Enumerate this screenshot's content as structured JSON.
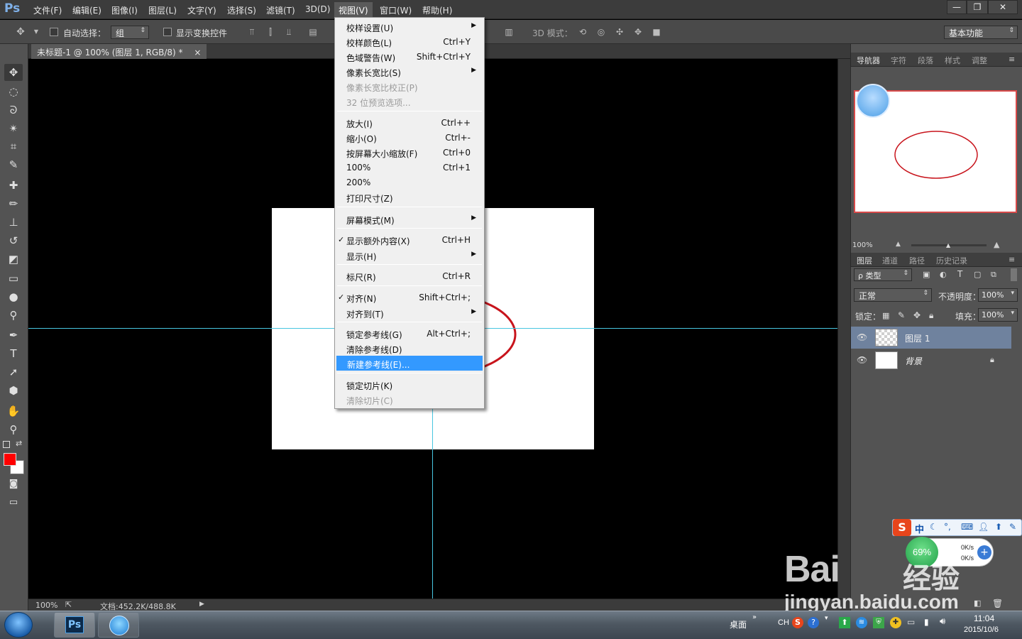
{
  "menubar": {
    "logo": "Ps",
    "items": [
      "文件(F)",
      "编辑(E)",
      "图像(I)",
      "图层(L)",
      "文字(Y)",
      "选择(S)",
      "滤镜(T)",
      "3D(D)",
      "视图(V)",
      "窗口(W)",
      "帮助(H)"
    ],
    "active_index": 8,
    "window_buttons": [
      "—",
      "❐",
      "✕"
    ]
  },
  "options": {
    "auto_select_label": "自动选择：",
    "auto_select_value": "组",
    "show_transform_label": "显示变换控件",
    "mode_3d_label": "3D 模式：",
    "workspace_value": "基本功能"
  },
  "document": {
    "tab_title": "未标题-1 @ 100% (图层 1, RGB/8) *",
    "tab_close": "×",
    "zoom": "100%",
    "doc_info": "文档:452.2K/488.8K",
    "colors": {
      "foreground": "#ff0000",
      "background": "#ffffff",
      "ellipse": "#c8141c",
      "guide": "#48c6e0"
    }
  },
  "view_menu": {
    "items": [
      {
        "label": "校样设置(U)",
        "shortcut": "",
        "submenu": true
      },
      {
        "label": "校样颜色(L)",
        "shortcut": "Ctrl+Y"
      },
      {
        "label": "色域警告(W)",
        "shortcut": "Shift+Ctrl+Y"
      },
      {
        "label": "像素长宽比(S)",
        "shortcut": "",
        "submenu": true
      },
      {
        "label": "像素长宽比校正(P)",
        "shortcut": "",
        "disabled": true
      },
      {
        "label": "32 位预览选项...",
        "shortcut": "",
        "disabled": true
      },
      {
        "label": "放大(I)",
        "shortcut": "Ctrl++"
      },
      {
        "label": "缩小(O)",
        "shortcut": "Ctrl+-"
      },
      {
        "label": "按屏幕大小缩放(F)",
        "shortcut": "Ctrl+0"
      },
      {
        "label": "100%",
        "shortcut": "Ctrl+1"
      },
      {
        "label": "200%",
        "shortcut": ""
      },
      {
        "label": "打印尺寸(Z)",
        "shortcut": ""
      },
      {
        "label": "屏幕模式(M)",
        "shortcut": "",
        "submenu": true
      },
      {
        "label": "显示额外内容(X)",
        "shortcut": "Ctrl+H",
        "checked": true
      },
      {
        "label": "显示(H)",
        "shortcut": "",
        "submenu": true
      },
      {
        "label": "标尺(R)",
        "shortcut": "Ctrl+R"
      },
      {
        "label": "对齐(N)",
        "shortcut": "Shift+Ctrl+;",
        "checked": true
      },
      {
        "label": "对齐到(T)",
        "shortcut": "",
        "submenu": true
      },
      {
        "label": "锁定参考线(G)",
        "shortcut": "Alt+Ctrl+;"
      },
      {
        "label": "清除参考线(D)",
        "shortcut": ""
      },
      {
        "label": "新建参考线(E)...",
        "shortcut": "",
        "highlighted": true
      },
      {
        "label": "锁定切片(K)",
        "shortcut": ""
      },
      {
        "label": "清除切片(C)",
        "shortcut": "",
        "disabled": true
      }
    ],
    "check_glyph": "✓",
    "submenu_glyph": "▶"
  },
  "navigator": {
    "tabs": [
      "导航器",
      "字符",
      "段落",
      "样式",
      "调整"
    ],
    "zoom": "100%"
  },
  "layers_panel": {
    "tabs": [
      "图层",
      "通道",
      "路径",
      "历史记录"
    ],
    "filter_label": "ρ 类型",
    "blend_mode": "正常",
    "opacity_label": "不透明度：",
    "opacity_value": "100%",
    "lock_label": "锁定：",
    "fill_label": "填充：",
    "fill_value": "100%",
    "layers": [
      {
        "name": "图层 1",
        "selected": true
      },
      {
        "name": "背景",
        "locked": true
      }
    ]
  },
  "taskbar": {
    "desktop_label": "桌面",
    "ime_label": "CH",
    "time": "11:04",
    "date": "2015/10/6",
    "apps": [
      "Ps",
      "browser"
    ]
  },
  "ime_bar": {
    "logo": "S",
    "mode": "中"
  },
  "net_widget": {
    "percent": "69%",
    "up": "0K/s",
    "down": "0K/s"
  },
  "watermark": {
    "bai": "Bai",
    "jingyan": "经验",
    "url": "jingyan.baidu.com"
  }
}
